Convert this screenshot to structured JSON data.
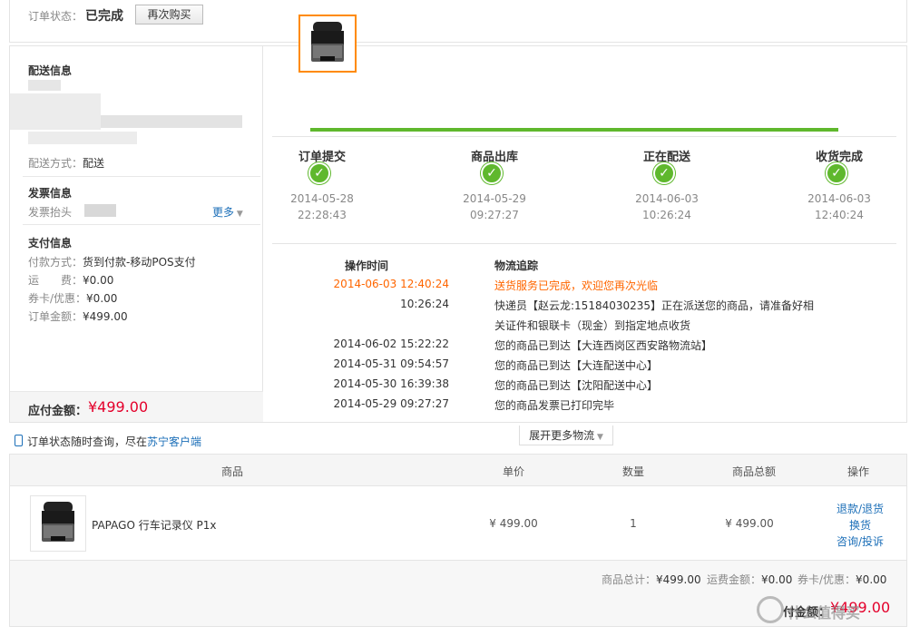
{
  "order_status": {
    "label": "订单状态：",
    "value": "已完成",
    "rebuy_button": "再次购买"
  },
  "delivery": {
    "title": "配送信息",
    "method_label": "配送方式：",
    "method_value": "配送"
  },
  "invoice": {
    "title": "发票信息",
    "header_label": "发票抬头",
    "more_link": "更多"
  },
  "payment": {
    "title": "支付信息",
    "method_label": "付款方式：",
    "method_value": "货到付款-移动POS支付",
    "freight_label": "运　　费：",
    "freight_value": "¥0.00",
    "coupon_label": "券卡/优惠：",
    "coupon_value": "¥0.00",
    "amount_label": "订单金额：",
    "amount_value": "¥499.00",
    "due_label": "应付金额：",
    "due_value": "¥499.00"
  },
  "progress": {
    "steps": [
      {
        "label": "订单提交",
        "date": "2014-05-28",
        "time": "22:28:43"
      },
      {
        "label": "商品出库",
        "date": "2014-05-29",
        "time": "09:27:27"
      },
      {
        "label": "正在配送",
        "date": "2014-06-03",
        "time": "10:26:24"
      },
      {
        "label": "收货完成",
        "date": "2014-06-03",
        "time": "12:40:24"
      }
    ]
  },
  "logistics": {
    "time_header": "操作时间",
    "track_header": "物流追踪",
    "entries": [
      {
        "time": "2014-06-03 12:40:24",
        "desc": "送货服务已完成，欢迎您再次光临"
      },
      {
        "time": "10:26:24",
        "desc": "快递员【赵云龙:15184030235】正在派送您的商品，请准备好相",
        "desc2": "关证件和银联卡（现金）到指定地点收货"
      },
      {
        "time": "2014-06-02 15:22:22",
        "desc": "您的商品已到达【大连西岗区西安路物流站】"
      },
      {
        "time": "2014-05-31 09:54:57",
        "desc": "您的商品已到达【大连配送中心】"
      },
      {
        "time": "2014-05-30 16:39:38",
        "desc": "您的商品已到达【沈阳配送中心】"
      },
      {
        "time": "2014-05-29 09:27:27",
        "desc": "您的商品发票已打印完毕"
      }
    ],
    "more_button": "展开更多物流"
  },
  "app_tip": {
    "text": "订单状态随时查询，尽在",
    "link": "苏宁客户端"
  },
  "table": {
    "headers": {
      "product": "商品",
      "price": "单价",
      "qty": "数量",
      "total": "商品总额",
      "ops": "操作"
    },
    "row": {
      "name": "PAPAGO 行车记录仪 P1x",
      "price": "¥ 499.00",
      "qty": "1",
      "total": "¥ 499.00",
      "ops": [
        "退款/退货",
        "换货",
        "咨询/投诉"
      ]
    },
    "summary": {
      "goods_label": "商品总计：",
      "goods_value": "¥499.00",
      "freight_label": "运费金额：",
      "freight_value": "¥0.00",
      "coupon_label": "券卡/优惠：",
      "coupon_value": "¥0.00",
      "final_label": "付金额：",
      "final_value": "¥499.00"
    }
  },
  "watermark": "什么值得买",
  "colors": {
    "accent_green": "#5fb82d",
    "price_red": "#e4002b",
    "link_blue": "#1c6fb8",
    "highlight_orange": "#ff6600"
  }
}
